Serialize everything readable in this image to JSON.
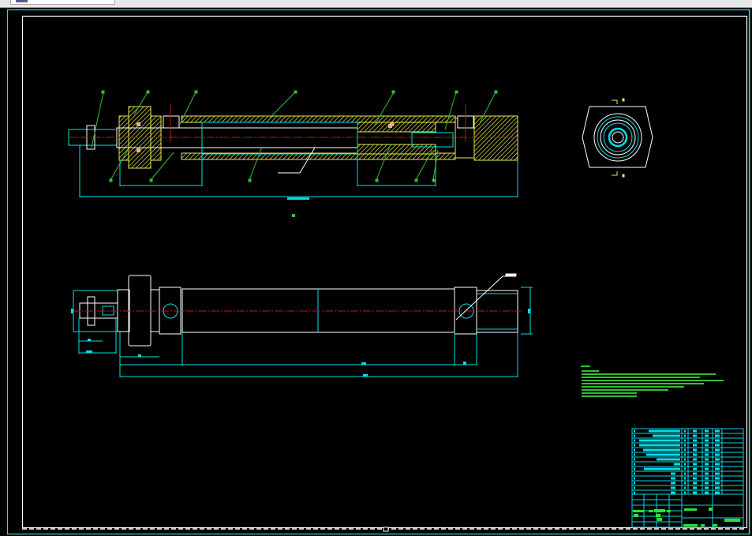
{
  "window": {
    "tab_icon": "drawing-file-icon"
  },
  "colors": {
    "background": "#000000",
    "outer_border": "#40d0d0",
    "frame": "#ffffff",
    "outline": "#ffffff",
    "dimension": "#00e0e0",
    "centerline": "#c01818",
    "hatch": "#e8e850",
    "leader": "#30c030",
    "notes": "#30c030",
    "table": "#00d8e0"
  },
  "views": [
    "section-view",
    "hex-end-view",
    "side-elevation-view"
  ]
}
